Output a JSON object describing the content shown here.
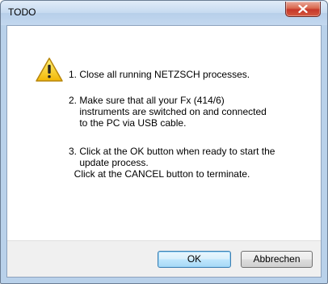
{
  "window": {
    "title": "TODO"
  },
  "message": {
    "icon": "warning-icon",
    "step1": "1. Close all running NETZSCH processes.",
    "step2_line1": "2. Make sure that all your Fx (414/6)",
    "step2_line2": "    instruments are switched on and connected",
    "step2_line3": "    to the PC via USB cable.",
    "step3_line1": "3. Click at the OK button when ready to start the",
    "step3_line2": "    update process.",
    "step3_line3": "  Click at the CANCEL button to terminate."
  },
  "buttons": {
    "ok_label": "OK",
    "cancel_label": "Abbrechen"
  },
  "colors": {
    "close_button": "#c6382a",
    "default_button_border": "#3c7fb1",
    "footer_background": "#f0f0f0"
  }
}
